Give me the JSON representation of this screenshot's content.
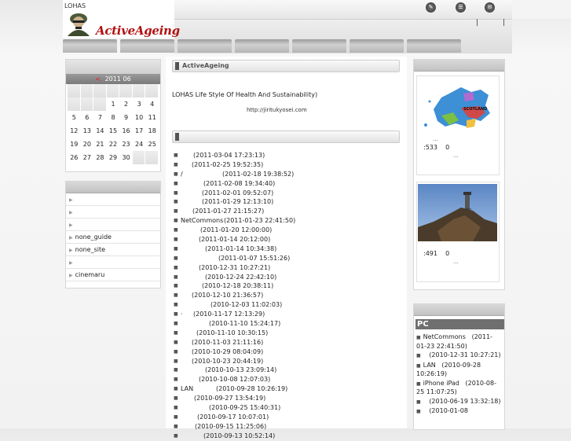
{
  "site": {
    "name": "LOHAS",
    "logo_text": "ActiveAgeing"
  },
  "header": {
    "pipes": "| |",
    "buttons": [
      "edit-icon",
      "list-icon",
      "mail-icon"
    ]
  },
  "calendar": {
    "year_month": "2011 06",
    "prev_arrow": "<",
    "weeks": [
      [
        "",
        "",
        "",
        "1",
        "2",
        "3",
        "4"
      ],
      [
        "5",
        "6",
        "7",
        "8",
        "9",
        "10",
        "11"
      ],
      [
        "12",
        "13",
        "14",
        "15",
        "16",
        "17",
        "18"
      ],
      [
        "19",
        "20",
        "21",
        "22",
        "23",
        "24",
        "25"
      ],
      [
        "26",
        "27",
        "28",
        "29",
        "30",
        "",
        ""
      ]
    ]
  },
  "links": [
    "",
    "",
    "",
    "none_guide",
    "none_site",
    "",
    "cinemaru"
  ],
  "main": {
    "heading": "ActiveAgeing",
    "intro": "LOHAS Life Style Of Health And Sustainability)",
    "url": "http://jiritukyosei.com",
    "posts": [
      {
        "name": "",
        "date": "(2011-03-04 17:23:13)",
        "x": 25
      },
      {
        "name": "",
        "date": "(2011-02-25 19:52:35)",
        "x": 23
      },
      {
        "name": "/",
        "date": "(2011-02-18 19:38:52)",
        "x": 62
      },
      {
        "name": "",
        "date": "(2011-02-08 19:34:40)",
        "x": 38
      },
      {
        "name": "",
        "date": "(2011-02-01 09:52:07)",
        "x": 36
      },
      {
        "name": "",
        "date": "(2011-01-29 12:13:10)",
        "x": 36
      },
      {
        "name": "",
        "date": "(2011-01-27 21:15:27)",
        "x": 24
      },
      {
        "name": "NetCommons",
        "date": "(2011-01-23 22:41:50)",
        "x": 64
      },
      {
        "name": "",
        "date": "(2011-01-20 12:00:00)",
        "x": 34
      },
      {
        "name": "",
        "date": "(2011-01-14 20:12:00)",
        "x": 32
      },
      {
        "name": "",
        "date": "(2011-01-14 10:34:38)",
        "x": 40
      },
      {
        "name": "",
        "date": "(2011-01-07 15:51:26)",
        "x": 57
      },
      {
        "name": "",
        "date": "(2010-12-31 10:27:21)",
        "x": 32
      },
      {
        "name": "",
        "date": "(2010-12-24 22:42:10)",
        "x": 40
      },
      {
        "name": "",
        "date": "(2010-12-18 20:38:11)",
        "x": 36
      },
      {
        "name": "",
        "date": "(2010-12-10 21:36:57)",
        "x": 23
      },
      {
        "name": "",
        "date": "(2010-12-03 11:02:03)",
        "x": 47
      },
      {
        "name": "·",
        "date": "(2010-11-17 12:13:29)",
        "x": 25
      },
      {
        "name": "",
        "date": "(2010-11-10 15:24:17)",
        "x": 45
      },
      {
        "name": "",
        "date": "(2010-11-10 10:30:15)",
        "x": 29
      },
      {
        "name": "",
        "date": "(2010-11-03 21:11:16)",
        "x": 23
      },
      {
        "name": "",
        "date": "(2010-10-29 08:04:09)",
        "x": 23
      },
      {
        "name": "",
        "date": "(2010-10-23 20:44:19)",
        "x": 23
      },
      {
        "name": "",
        "date": "(2010-10-13 23:09:14)",
        "x": 40
      },
      {
        "name": "",
        "date": "(2010-10-08 12:07:03)",
        "x": 32
      },
      {
        "name": "LAN",
        "date": "(2010-09-28 10:26:19)",
        "x": 54
      },
      {
        "name": "",
        "date": "(2010-09-27 13:54:19)",
        "x": 26
      },
      {
        "name": "",
        "date": "(2010-09-25 15:40:31)",
        "x": 45
      },
      {
        "name": "",
        "date": "(2010-09-17 10:07:01)",
        "x": 30
      },
      {
        "name": "",
        "date": "(2010-09-15 11:25:06)",
        "x": 27
      },
      {
        "name": "",
        "date": "(2010-09-13 10:52:14)",
        "x": 38
      }
    ]
  },
  "photos": [
    {
      "caption": "SCOTLAND",
      "dots": "...",
      "views": ":533",
      "comments": "0",
      "dots2": "..."
    },
    {
      "views": ":491",
      "comments": "0",
      "dots2": "..."
    }
  ],
  "pc": {
    "title": "PC",
    "items": [
      {
        "name": "NetCommons",
        "date": "(2011-01-23 22:41:50)"
      },
      {
        "name": "",
        "date": "(2010-12-31 10:27:21)"
      },
      {
        "name": "LAN",
        "date": "(2010-09-28 10:26:19)"
      },
      {
        "name": "iPhone iPad",
        "date": "(2010-08-25 11:07:25)"
      },
      {
        "name": "",
        "date": "(2010-06-19 13:32:18)"
      },
      {
        "name": "",
        "date": "(2010-01-08"
      }
    ]
  }
}
